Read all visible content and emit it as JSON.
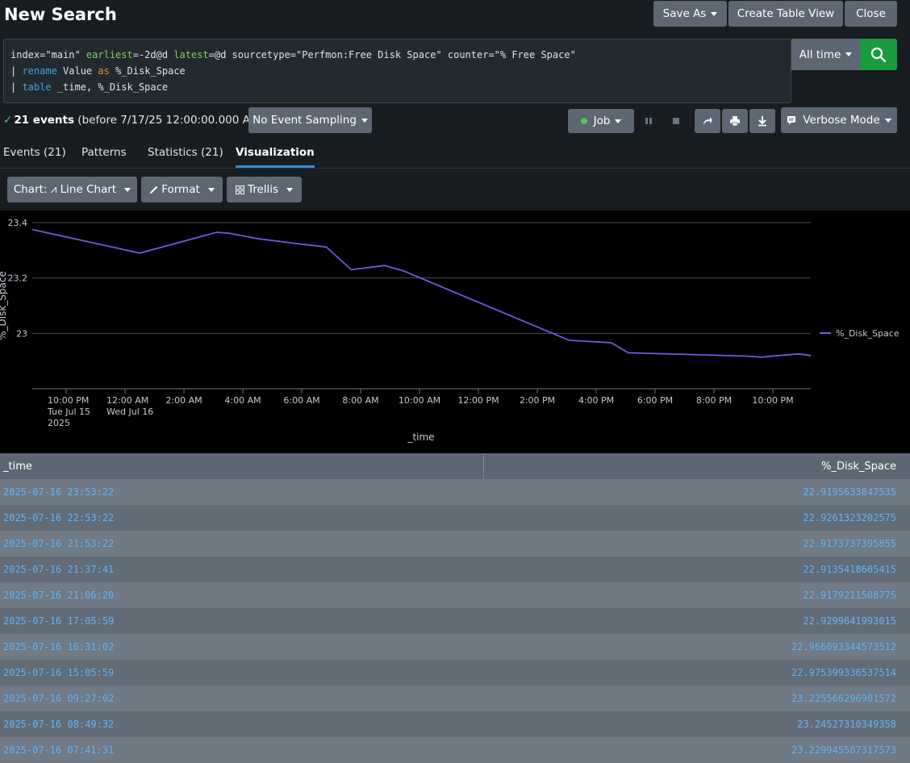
{
  "header": {
    "title": "New Search",
    "save_as": "Save As",
    "create_table_view": "Create Table View",
    "close": "Close"
  },
  "search": {
    "line1_a": "index=\"main\" ",
    "line1_earliest_kw": "earliest",
    "line1_earliest_val": "=-2d@d ",
    "line1_latest_kw": "latest",
    "line1_latest_val": "=@d  sourcetype=\"Perfmon:Free Disk Space\" counter=\"% Free Space\"",
    "line2_pipe": "| ",
    "line2_cmd": "rename",
    "line2_a": " Value ",
    "line2_as": "as",
    "line2_b": " %_Disk_Space",
    "line3_pipe": "| ",
    "line3_cmd": "table",
    "line3_a": " _time, %_Disk_Space",
    "time_range": "All time"
  },
  "status": {
    "events_count": "21 events",
    "events_suffix": " (before 7/17/25 12:00:00.000 AM)",
    "sampling": "No Event Sampling",
    "job": "Job",
    "mode": "Verbose Mode"
  },
  "tabs": {
    "events": "Events (21)",
    "patterns": "Patterns",
    "statistics": "Statistics (21)",
    "visualization": "Visualization"
  },
  "viz_toolbar": {
    "chart": "Chart: ⩘ Line Chart",
    "format": "Format",
    "trellis": "Trellis"
  },
  "colors": {
    "line": "#7b56db",
    "accent_tab": "#2d8fd4",
    "search_btn": "#1a9c3e"
  },
  "chart_data": {
    "type": "line",
    "xlabel": "_time",
    "ylabel": "%_Disk_Space",
    "ylim": [
      22.8,
      23.4
    ],
    "yticks": [
      "23",
      "23.2",
      "23.4"
    ],
    "xticks": [
      {
        "label": "10:00 PM",
        "sub1": "Tue Jul 15",
        "sub2": "2025",
        "t": "2025-07-15 22:00"
      },
      {
        "label": "12:00 AM",
        "sub1": "Wed Jul 16",
        "sub2": "",
        "t": "2025-07-16 00:00"
      },
      {
        "label": "2:00 AM",
        "sub1": "",
        "sub2": "",
        "t": "2025-07-16 02:00"
      },
      {
        "label": "4:00 AM",
        "sub1": "",
        "sub2": "",
        "t": "2025-07-16 04:00"
      },
      {
        "label": "6:00 AM",
        "sub1": "",
        "sub2": "",
        "t": "2025-07-16 06:00"
      },
      {
        "label": "8:00 AM",
        "sub1": "",
        "sub2": "",
        "t": "2025-07-16 08:00"
      },
      {
        "label": "10:00 AM",
        "sub1": "",
        "sub2": "",
        "t": "2025-07-16 10:00"
      },
      {
        "label": "12:00 PM",
        "sub1": "",
        "sub2": "",
        "t": "2025-07-16 12:00"
      },
      {
        "label": "2:00 PM",
        "sub1": "",
        "sub2": "",
        "t": "2025-07-16 14:00"
      },
      {
        "label": "4:00 PM",
        "sub1": "",
        "sub2": "",
        "t": "2025-07-16 16:00"
      },
      {
        "label": "6:00 PM",
        "sub1": "",
        "sub2": "",
        "t": "2025-07-16 18:00"
      },
      {
        "label": "8:00 PM",
        "sub1": "",
        "sub2": "",
        "t": "2025-07-16 20:00"
      },
      {
        "label": "10:00 PM",
        "sub1": "",
        "sub2": "",
        "t": "2025-07-16 22:00"
      }
    ],
    "series": [
      {
        "name": "%_Disk_Space",
        "points": [
          {
            "x": "2025-07-15 21:30",
            "y": 23.375
          },
          {
            "x": "2025-07-16 00:30",
            "y": 23.29
          },
          {
            "x": "2025-07-16 03:07",
            "y": 23.365
          },
          {
            "x": "2025-07-16 03:30",
            "y": 23.362
          },
          {
            "x": "2025-07-16 04:30",
            "y": 23.342
          },
          {
            "x": "2025-07-16 06:00",
            "y": 23.322
          },
          {
            "x": "2025-07-16 06:50",
            "y": 23.312
          },
          {
            "x": "2025-07-16 07:41",
            "y": 23.23
          },
          {
            "x": "2025-07-16 08:49",
            "y": 23.245
          },
          {
            "x": "2025-07-16 09:27",
            "y": 23.226
          },
          {
            "x": "2025-07-16 15:05",
            "y": 22.975
          },
          {
            "x": "2025-07-16 16:31",
            "y": 22.966
          },
          {
            "x": "2025-07-16 17:05",
            "y": 22.93
          },
          {
            "x": "2025-07-16 21:06",
            "y": 22.918
          },
          {
            "x": "2025-07-16 21:37",
            "y": 22.914
          },
          {
            "x": "2025-07-16 21:53",
            "y": 22.917
          },
          {
            "x": "2025-07-16 22:53",
            "y": 22.926
          },
          {
            "x": "2025-07-16 23:53",
            "y": 22.92
          }
        ]
      }
    ],
    "legend": "right",
    "grid": true
  },
  "table": {
    "col_time": "_time",
    "col_value": "%_Disk_Space",
    "rows": [
      {
        "time": "2025-07-16 23:53:22",
        "value": "22.9195633847535"
      },
      {
        "time": "2025-07-16 22:53:22",
        "value": "22.9261323202575"
      },
      {
        "time": "2025-07-16 21:53:22",
        "value": "22.9173737395855"
      },
      {
        "time": "2025-07-16 21:37:41",
        "value": "22.9135418605415"
      },
      {
        "time": "2025-07-16 21:06:20",
        "value": "22.9179211508775"
      },
      {
        "time": "2025-07-16 17:05:59",
        "value": "22.9299641993015"
      },
      {
        "time": "2025-07-16 16:31:02",
        "value": "22.966093344573512"
      },
      {
        "time": "2025-07-16 15:05:59",
        "value": "22.975399336537514"
      },
      {
        "time": "2025-07-16 09:27:02",
        "value": "23.225566296981572"
      },
      {
        "time": "2025-07-16 08:49:32",
        "value": "23.24527310349358"
      },
      {
        "time": "2025-07-16 07:41:31",
        "value": "23.229945587317573"
      }
    ]
  }
}
